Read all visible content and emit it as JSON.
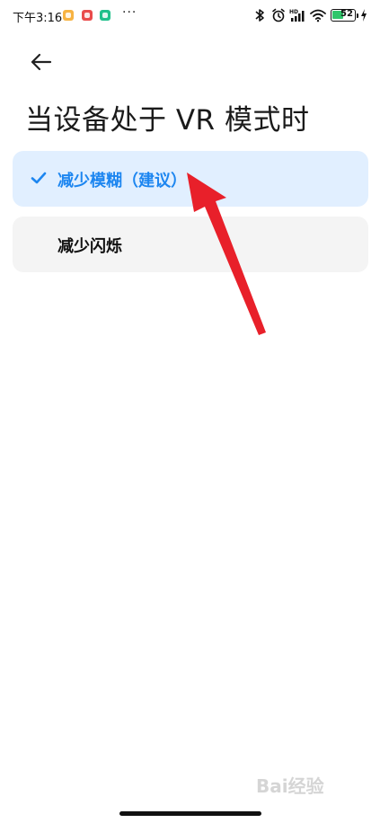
{
  "status_bar": {
    "time": "下午3:16",
    "more": "···",
    "battery_level": "52",
    "battery_fraction": 0.52,
    "icons": [
      "notes-app-icon",
      "red-app-icon",
      "green-app-icon",
      "bluetooth-icon",
      "alarm-icon",
      "hd-signal-icon",
      "wifi-icon",
      "battery-icon",
      "charging-icon"
    ]
  },
  "header": {
    "back_icon": "back-arrow-icon",
    "title": "当设备处于 VR 模式时"
  },
  "options": [
    {
      "label": "减少模糊（建议）",
      "selected": true,
      "icon": "checkmark-icon"
    },
    {
      "label": "减少闪烁",
      "selected": false
    }
  ],
  "colors": {
    "accent": "#1d86f0",
    "selected_bg": "#e1efff",
    "option_bg": "#f4f4f4",
    "annotation_arrow": "#e8202a"
  },
  "watermark": {
    "text": "Bai经验"
  }
}
